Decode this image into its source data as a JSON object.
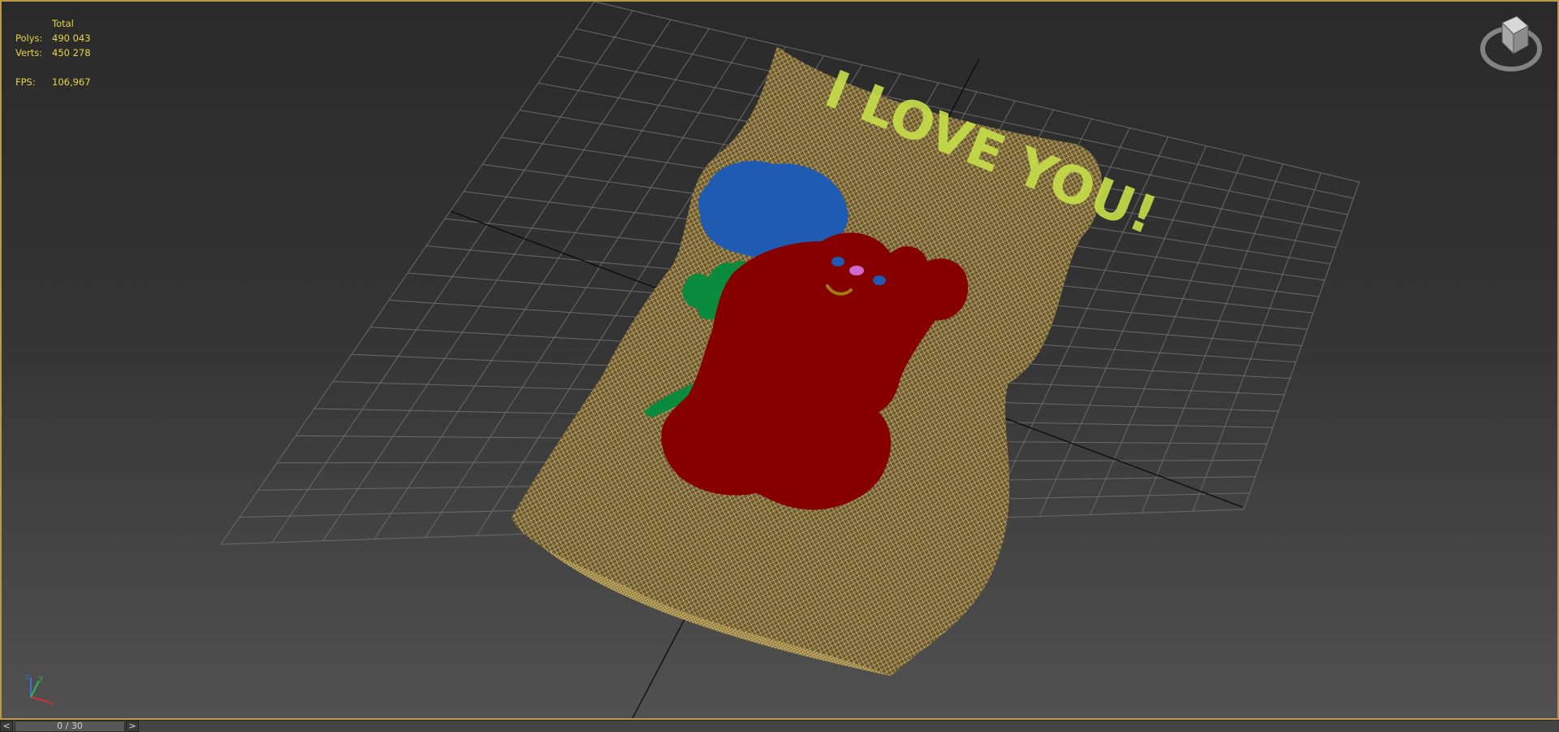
{
  "stats": {
    "header": "Total",
    "polys_label": "Polys:",
    "polys_value": "490 043",
    "verts_label": "Verts:",
    "verts_value": "450 278",
    "fps_label": "FPS:",
    "fps_value": "106,967"
  },
  "model": {
    "inscription": "I LOVE YOU!"
  },
  "axes": {
    "x": "x",
    "y": "y",
    "z": "z"
  },
  "timeline": {
    "prev": "<",
    "next": ">",
    "frame": "0 / 30"
  },
  "colors": {
    "viewport_border": "#b89a4a",
    "stats_text": "#e8d44a",
    "mesh_wire": "#e8c96a",
    "bear": "#870000",
    "rose": "#1f5bb3",
    "leaves": "#0a8a3c",
    "lettering": "#c8e04a"
  }
}
